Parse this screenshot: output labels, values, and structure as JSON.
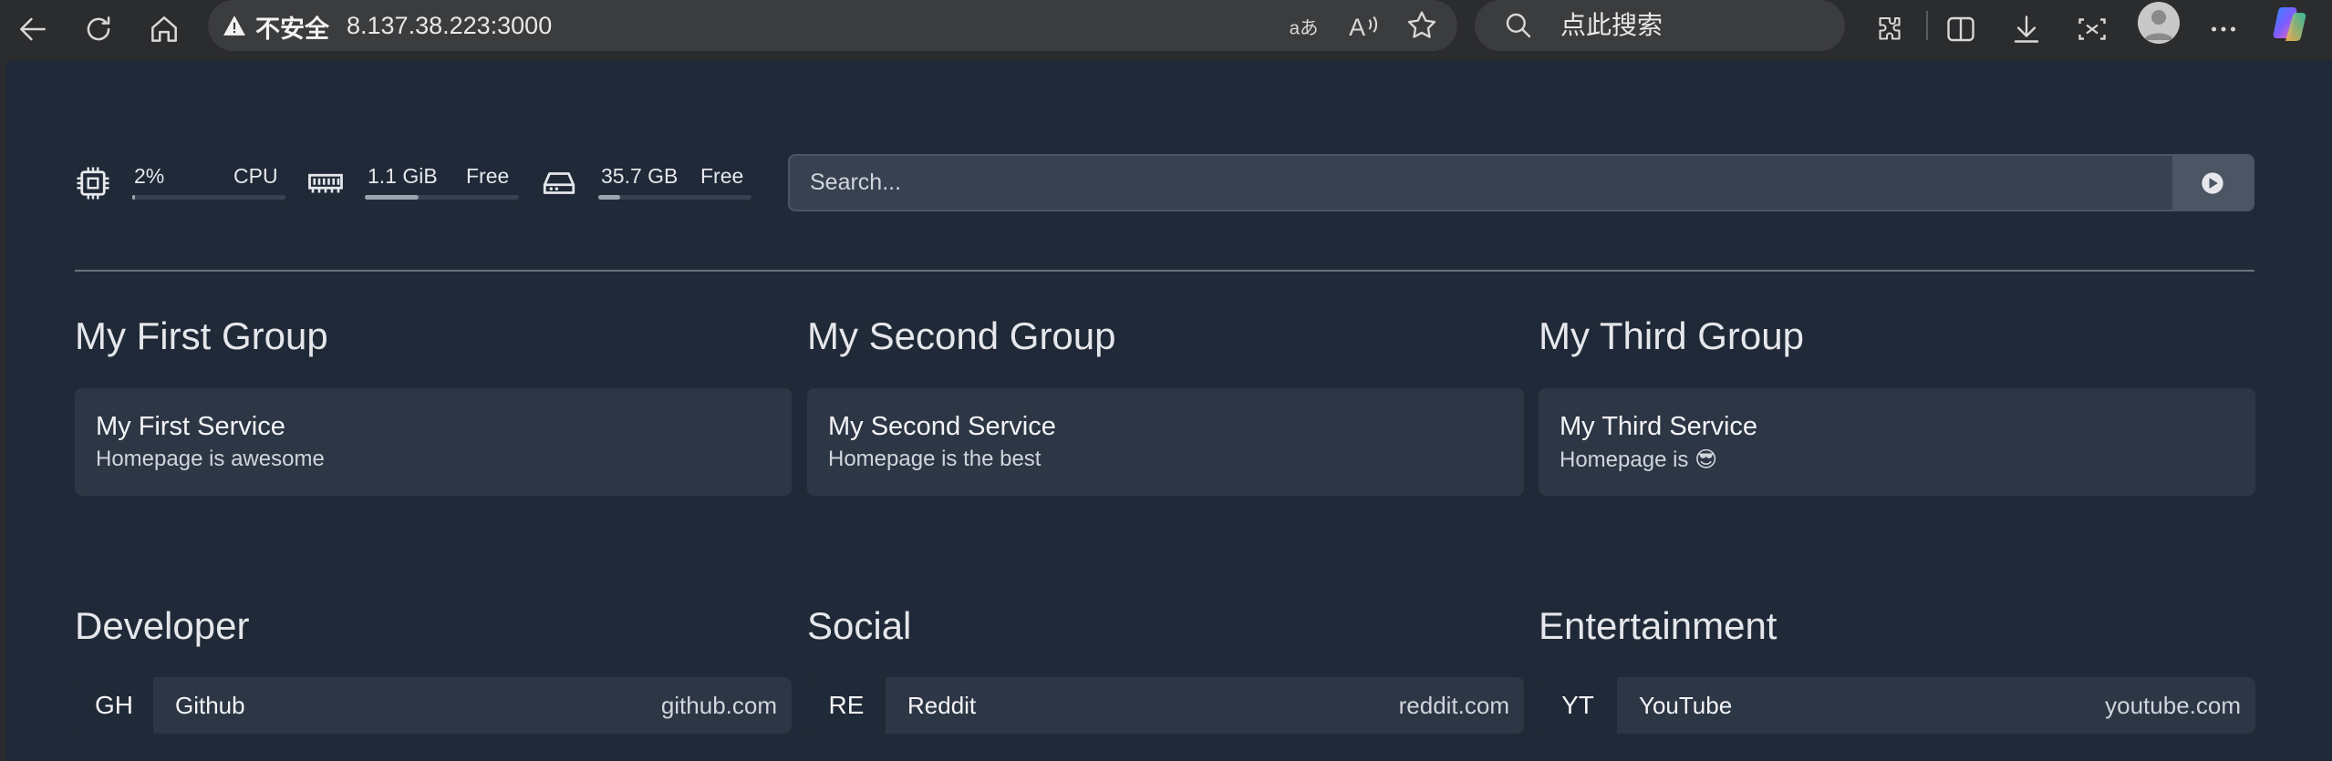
{
  "browser": {
    "security_label": "不安全",
    "url": "8.137.38.223:3000",
    "search_placeholder": "点此搜索"
  },
  "stats": {
    "cpu": {
      "value": "2%",
      "label": "CPU",
      "fill": 0.02
    },
    "memory": {
      "value": "1.1 GiB",
      "label": "Free",
      "fill": 0.35
    },
    "disk": {
      "value": "35.7 GB",
      "label": "Free",
      "fill": 0.14
    }
  },
  "search": {
    "placeholder": "Search..."
  },
  "service_groups": [
    {
      "title": "My First Group",
      "service": {
        "name": "My First Service",
        "description": "Homepage is awesome"
      }
    },
    {
      "title": "My Second Group",
      "service": {
        "name": "My Second Service",
        "description": "Homepage is the best"
      }
    },
    {
      "title": "My Third Group",
      "service": {
        "name": "My Third Service",
        "description": "Homepage is 😎"
      }
    }
  ],
  "bookmark_groups": [
    {
      "title": "Developer",
      "bookmark": {
        "abbr": "GH",
        "name": "Github",
        "href": "github.com"
      }
    },
    {
      "title": "Social",
      "bookmark": {
        "abbr": "RE",
        "name": "Reddit",
        "href": "reddit.com"
      }
    },
    {
      "title": "Entertainment",
      "bookmark": {
        "abbr": "YT",
        "name": "YouTube",
        "href": "youtube.com"
      }
    }
  ],
  "colors": {
    "page_bg": "#1f2937",
    "card_bg": "#2c3645",
    "chrome_bg": "#2b2c2e"
  }
}
